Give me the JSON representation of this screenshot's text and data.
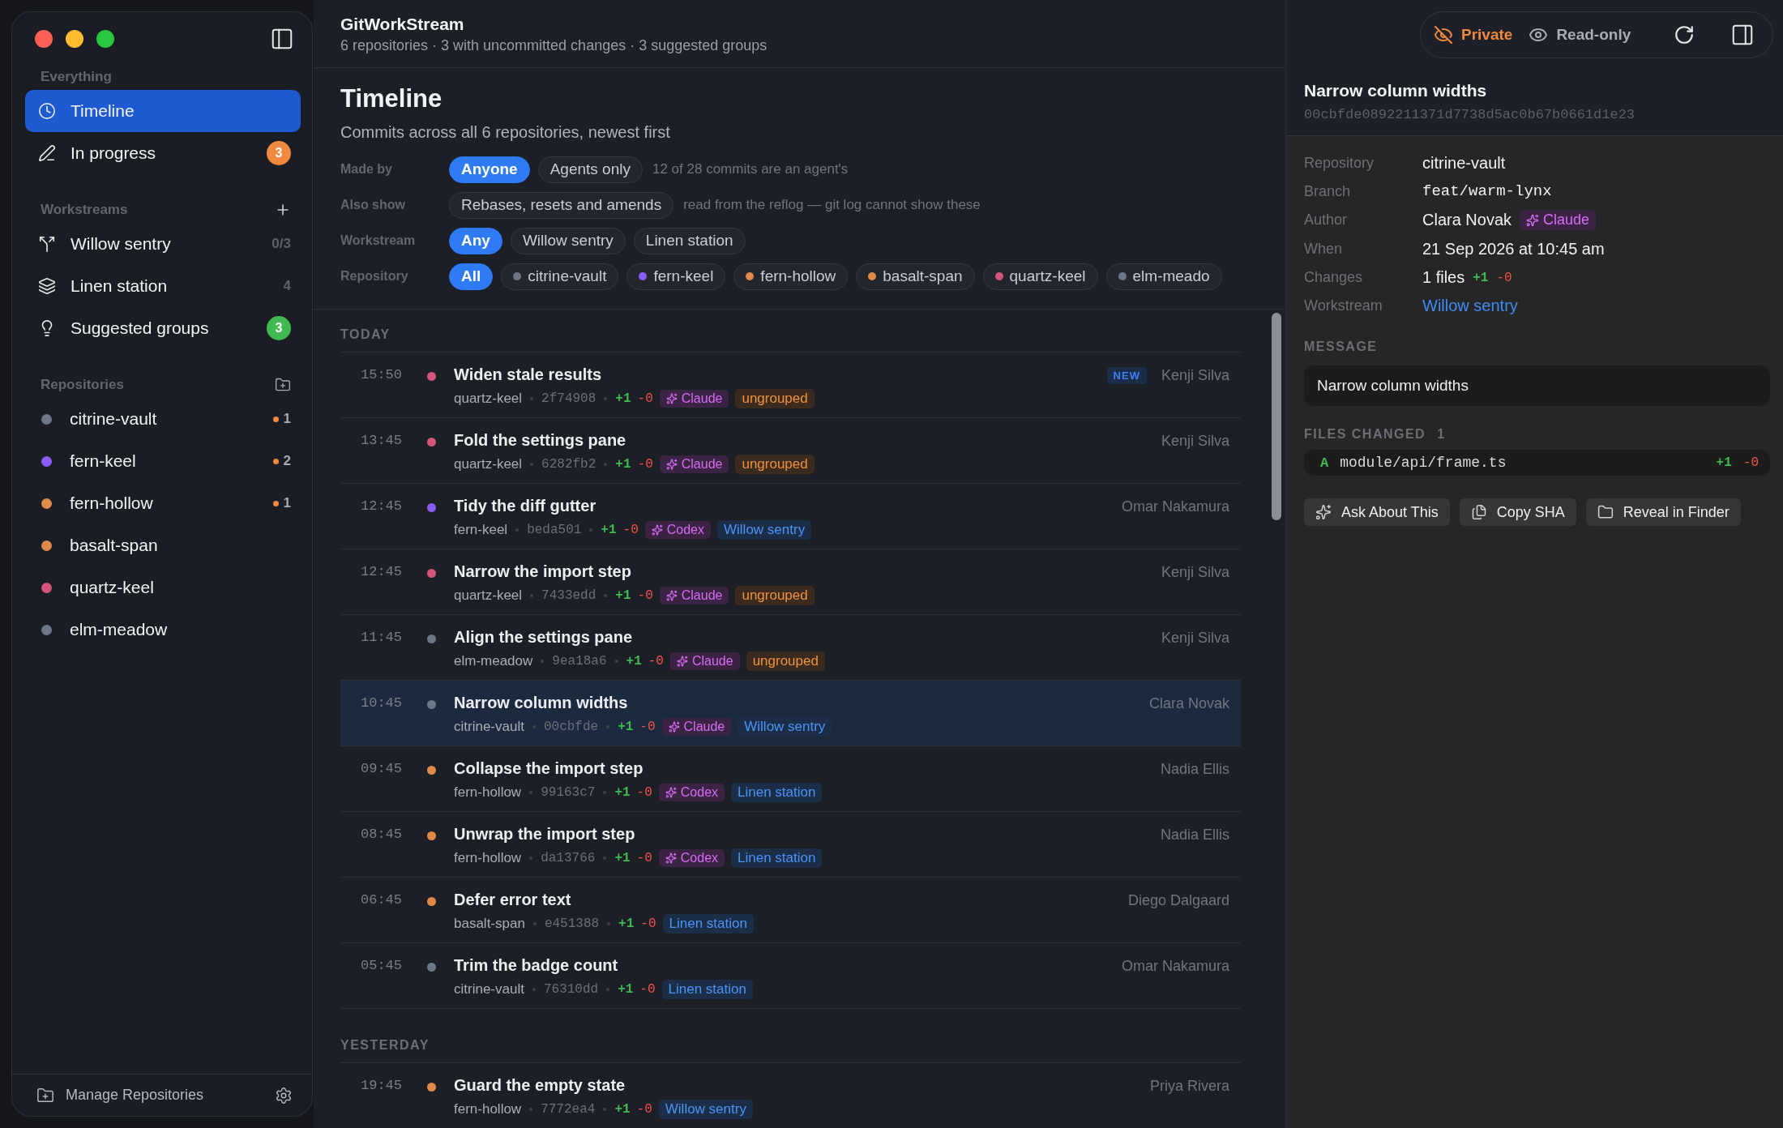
{
  "app": {
    "title": "GitWorkStream",
    "subtitle": "6 repositories · 3 with uncommitted changes · 3 suggested groups"
  },
  "sidebar": {
    "sections": [
      {
        "heading": "Everything",
        "items": [
          {
            "label": "Timeline",
            "selected": true
          },
          {
            "label": "In progress",
            "selected": false,
            "badge": "3",
            "color": "#f0883e"
          }
        ]
      },
      {
        "heading": "Workstreams",
        "items": [
          {
            "label": "Willow sentry",
            "selected": false,
            "count": "0/3"
          },
          {
            "label": "Linen station",
            "selected": false,
            "count": "4"
          },
          {
            "label": "Suggested groups",
            "selected": false,
            "badge": "3",
            "color": "#3fb950"
          }
        ]
      },
      {
        "heading": "Repositories",
        "items": [
          {
            "label": "citrine-vault",
            "selected": false,
            "color": "#6e7787",
            "changes": "1"
          },
          {
            "label": "fern-keel",
            "selected": false,
            "color": "#8b5cf6",
            "changes": "2"
          },
          {
            "label": "fern-hollow",
            "selected": false,
            "color": "#e08a4a",
            "changes": "1"
          },
          {
            "label": "basalt-span",
            "selected": false,
            "color": "#e08a4a"
          },
          {
            "label": "quartz-keel",
            "selected": false,
            "color": "#d4547a"
          },
          {
            "label": "elm-meadow",
            "selected": false,
            "color": "#6e7787"
          }
        ]
      }
    ],
    "footer": "Manage Repositories"
  },
  "timeline": {
    "title": "Timeline",
    "subtitle": "Commits across all 6 repositories, newest first",
    "filters": [
      {
        "label": "Made by",
        "options": [
          {
            "label": "Anyone",
            "selected": true
          },
          {
            "label": "Agents only",
            "selected": false
          }
        ],
        "note": "12 of 28 commits are an agent's"
      },
      {
        "label": "Also show",
        "options": [
          {
            "label": "Rebases, resets and amends",
            "selected": false
          }
        ],
        "note": "read from the reflog — git log cannot show these"
      },
      {
        "label": "Workstream",
        "options": [
          {
            "label": "Any",
            "selected": true
          },
          {
            "label": "Willow sentry",
            "selected": false
          },
          {
            "label": "Linen station",
            "selected": false
          }
        ]
      },
      {
        "label": "Repository",
        "options": [
          {
            "label": "All",
            "selected": true
          },
          {
            "label": "citrine-vault",
            "selected": false,
            "color": "#6e7787"
          },
          {
            "label": "fern-keel",
            "selected": false,
            "color": "#8b5cf6"
          },
          {
            "label": "fern-hollow",
            "selected": false,
            "color": "#e08a4a"
          },
          {
            "label": "basalt-span",
            "selected": false,
            "color": "#e08a4a"
          },
          {
            "label": "quartz-keel",
            "selected": false,
            "color": "#d4547a"
          },
          {
            "label": "elm-meado",
            "selected": false,
            "color": "#6e7787"
          }
        ]
      }
    ],
    "groups": [
      {
        "heading": "TODAY",
        "commits": [
          {
            "time": "15:50",
            "color": "#d4547a",
            "title": "Widen stale results",
            "repo": "quartz-keel",
            "sha": "2f74908",
            "added": "+1",
            "removed": "-0",
            "agent": "Claude",
            "tag": {
              "label": "ungrouped",
              "kind": "ungrouped"
            },
            "badge": "NEW",
            "author": "Kenji Silva",
            "selected": false
          },
          {
            "time": "13:45",
            "color": "#d4547a",
            "title": "Fold the settings pane",
            "repo": "quartz-keel",
            "sha": "6282fb2",
            "added": "+1",
            "removed": "-0",
            "agent": "Claude",
            "tag": {
              "label": "ungrouped",
              "kind": "ungrouped"
            },
            "author": "Kenji Silva",
            "selected": false
          },
          {
            "time": "12:45",
            "color": "#8b5cf6",
            "title": "Tidy the diff gutter",
            "repo": "fern-keel",
            "sha": "beda501",
            "added": "+1",
            "removed": "-0",
            "agent": "Codex",
            "tag": {
              "label": "Willow sentry",
              "kind": "workstream"
            },
            "author": "Omar Nakamura",
            "selected": false
          },
          {
            "time": "12:45",
            "color": "#d4547a",
            "title": "Narrow the import step",
            "repo": "quartz-keel",
            "sha": "7433edd",
            "added": "+1",
            "removed": "-0",
            "agent": "Claude",
            "tag": {
              "label": "ungrouped",
              "kind": "ungrouped"
            },
            "author": "Kenji Silva",
            "selected": false
          },
          {
            "time": "11:45",
            "color": "#6e7787",
            "title": "Align the settings pane",
            "repo": "elm-meadow",
            "sha": "9ea18a6",
            "added": "+1",
            "removed": "-0",
            "agent": "Claude",
            "tag": {
              "label": "ungrouped",
              "kind": "ungrouped"
            },
            "author": "Kenji Silva",
            "selected": false
          },
          {
            "time": "10:45",
            "color": "#6e7787",
            "title": "Narrow column widths",
            "repo": "citrine-vault",
            "sha": "00cbfde",
            "added": "+1",
            "removed": "-0",
            "agent": "Claude",
            "tag": {
              "label": "Willow sentry",
              "kind": "workstream"
            },
            "author": "Clara Novak",
            "selected": true
          },
          {
            "time": "09:45",
            "color": "#e08a4a",
            "title": "Collapse the import step",
            "repo": "fern-hollow",
            "sha": "99163c7",
            "added": "+1",
            "removed": "-0",
            "agent": "Codex",
            "tag": {
              "label": "Linen station",
              "kind": "workstream"
            },
            "author": "Nadia Ellis",
            "selected": false
          },
          {
            "time": "08:45",
            "color": "#e08a4a",
            "title": "Unwrap the import step",
            "repo": "fern-hollow",
            "sha": "da13766",
            "added": "+1",
            "removed": "-0",
            "agent": "Codex",
            "tag": {
              "label": "Linen station",
              "kind": "workstream"
            },
            "author": "Nadia Ellis",
            "selected": false
          },
          {
            "time": "06:45",
            "color": "#e08a4a",
            "title": "Defer error text",
            "repo": "basalt-span",
            "sha": "e451388",
            "added": "+1",
            "removed": "-0",
            "tag": {
              "label": "Linen station",
              "kind": "workstream"
            },
            "author": "Diego Dalgaard",
            "selected": false
          },
          {
            "time": "05:45",
            "color": "#6e7787",
            "title": "Trim the badge count",
            "repo": "citrine-vault",
            "sha": "76310dd",
            "added": "+1",
            "removed": "-0",
            "tag": {
              "label": "Linen station",
              "kind": "workstream"
            },
            "author": "Omar Nakamura",
            "selected": false
          }
        ]
      },
      {
        "heading": "YESTERDAY",
        "commits": [
          {
            "time": "19:45",
            "color": "#e08a4a",
            "title": "Guard the empty state",
            "repo": "fern-hollow",
            "sha": "7772ea4",
            "added": "+1",
            "removed": "-0",
            "tag": {
              "label": "Willow sentry",
              "kind": "workstream"
            },
            "author": "Priya Rivera",
            "selected": false
          }
        ]
      }
    ]
  },
  "detail": {
    "toolbar": {
      "private": "Private",
      "readonly": "Read-only"
    },
    "title": "Narrow column widths",
    "sha": "00cbfde0892211371d7738d5ac0b67b0661d1e23",
    "fields": [
      {
        "kind": "text",
        "label": "Repository",
        "value": "citrine-vault"
      },
      {
        "kind": "mono",
        "label": "Branch",
        "value": "feat/warm-lynx"
      },
      {
        "kind": "author",
        "label": "Author",
        "value": "Clara Novak",
        "agent": "Claude"
      },
      {
        "kind": "text",
        "label": "When",
        "value": "21 Sep 2026 at 10:45 am"
      },
      {
        "kind": "changes",
        "label": "Changes",
        "value": "1 files",
        "added": "+1",
        "removed": "-0"
      },
      {
        "kind": "link",
        "label": "Workstream",
        "value": "Willow sentry"
      }
    ],
    "message_heading": "MESSAGE",
    "message": "Narrow column widths",
    "files_heading": "FILES CHANGED",
    "files_count": "1",
    "files": [
      {
        "status": "A",
        "path": "module/api/frame.ts",
        "added": "+1",
        "removed": "-0"
      }
    ],
    "buttons": [
      "Ask About This",
      "Copy SHA",
      "Reveal in Finder"
    ]
  }
}
